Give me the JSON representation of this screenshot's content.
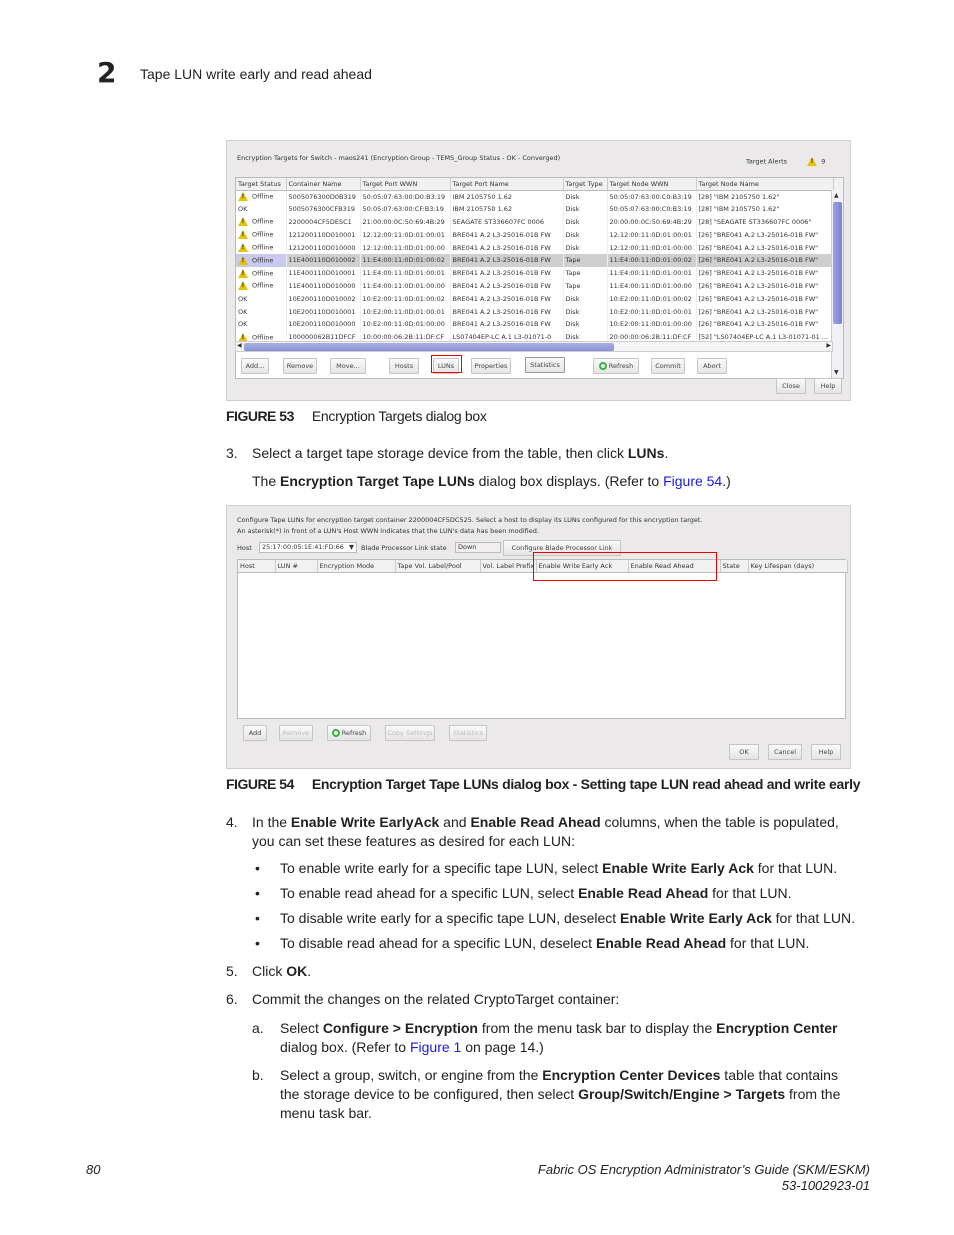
{
  "header": {
    "chapter_number": "2",
    "running_head": "Tape LUN write early and read ahead"
  },
  "figure53": {
    "dialog": {
      "title": "Encryption Targets for Switch - maos241 (Encryption Group - TEMS_Group Status - OK - Converged)",
      "target_alerts_label": "Target Alerts",
      "target_alerts_count": "9",
      "columns": [
        "Target Status",
        "Container Name",
        "Target Port WWN",
        "Target Port Name",
        "Target Type",
        "Target Node WWN",
        "Target Node Name"
      ],
      "rows": [
        {
          "status": "Offline",
          "warn": true,
          "container": "5005076300D0B319",
          "port_wwn": "50:05:07:63:00:D0:B3:19",
          "port_name": "IBM      2105750       1.62",
          "type": "Disk",
          "node_wwn": "50:05:07:63:00:C0:B3:19",
          "node_name": "[28] \"IBM      2105750       1.62\""
        },
        {
          "status": "OK",
          "warn": false,
          "container": "5005076300CFB319",
          "port_wwn": "50:05:07:63:00:CF:B3:19",
          "port_name": "IBM      2105750       1.62",
          "type": "Disk",
          "node_wwn": "50:05:07:63:00:C0:B3:19",
          "node_name": "[28] \"IBM      2105750       1.62\""
        },
        {
          "status": "Offline",
          "warn": true,
          "container": "2200004CF5DESC1",
          "port_wwn": "21:00:00:0C:50:69:4B:29",
          "port_name": "SEAGATE ST336607FC      0006",
          "type": "Disk",
          "node_wwn": "20:00:00:0C:50:69:4B:29",
          "node_name": "[28] \"SEAGATE ST336607FC      0006\""
        },
        {
          "status": "Offline",
          "warn": true,
          "container": "121200110D010001",
          "port_wwn": "12:12:00:11:0D:01:00:01",
          "port_name": "BRE041 A.2 L3-25016-01B FW",
          "type": "Disk",
          "node_wwn": "12:12:00:11:0D:01:00:01",
          "node_name": "[26] \"BRE041 A.2 L3-25016-01B FW\""
        },
        {
          "status": "Offline",
          "warn": true,
          "container": "121200110D010000",
          "port_wwn": "12:12:00:11:0D:01:00:00",
          "port_name": "BRE041 A.2 L3-25016-01B FW",
          "type": "Disk",
          "node_wwn": "12:12:00:11:0D:01:00:00",
          "node_name": "[26] \"BRE041 A.2 L3-25016-01B FW\""
        },
        {
          "status": "Offline",
          "warn": true,
          "selected": true,
          "container": "11E400110D010002",
          "port_wwn": "11:E4:00:11:0D:01:00:02",
          "port_name": "BRE041 A.2 L3-25016-01B FW",
          "type": "Tape",
          "node_wwn": "11:E4:00:11:0D:01:00:02",
          "node_name": "[26] \"BRE041 A.2 L3-25016-01B FW\""
        },
        {
          "status": "Offline",
          "warn": true,
          "container": "11E400110D010001",
          "port_wwn": "11:E4:00:11:0D:01:00:01",
          "port_name": "BRE041 A.2 L3-25016-01B FW",
          "type": "Tape",
          "node_wwn": "11:E4:00:11:0D:01:00:01",
          "node_name": "[26] \"BRE041 A.2 L3-25016-01B FW\""
        },
        {
          "status": "Offline",
          "warn": true,
          "container": "11E400110D010000",
          "port_wwn": "11:E4:00:11:0D:01:00:00",
          "port_name": "BRE041 A.2 L3-25016-01B FW",
          "type": "Tape",
          "node_wwn": "11:E4:00:11:0D:01:00:00",
          "node_name": "[26] \"BRE041 A.2 L3-25016-01B FW\""
        },
        {
          "status": "OK",
          "warn": false,
          "container": "10E200110D010002",
          "port_wwn": "10:E2:00:11:0D:01:00:02",
          "port_name": "BRE041 A.2 L3-25016-01B FW",
          "type": "Disk",
          "node_wwn": "10:E2:00:11:0D:01:00:02",
          "node_name": "[26] \"BRE041 A.2 L3-25016-01B FW\""
        },
        {
          "status": "OK",
          "warn": false,
          "container": "10E200110D010001",
          "port_wwn": "10:E2:00:11:0D:01:00:01",
          "port_name": "BRE041 A.2 L3-25016-01B FW",
          "type": "Disk",
          "node_wwn": "10:E2:00:11:0D:01:00:01",
          "node_name": "[26] \"BRE041 A.2 L3-25016-01B FW\""
        },
        {
          "status": "OK",
          "warn": false,
          "container": "10E200110D010000",
          "port_wwn": "10:E2:00:11:0D:01:00:00",
          "port_name": "BRE041 A.2 L3-25016-01B FW",
          "type": "Disk",
          "node_wwn": "10:E2:00:11:0D:01:00:00",
          "node_name": "[26] \"BRE041 A.2 L3-25016-01B FW\""
        },
        {
          "status": "Offline",
          "warn": true,
          "container": "100000062B11DFCF",
          "port_wwn": "10:00:00:06:2B:11:DF:CF",
          "port_name": "LS07404EP-LC A.1 L3-01071-0",
          "type": "Disk",
          "node_wwn": "20:00:00:06:2B:11:DF:CF",
          "node_name": "[52] \"LS07404EP-LC A.1 L3-01071-01 ..."
        }
      ],
      "buttons": {
        "add": "Add...",
        "remove": "Remove",
        "move": "Move...",
        "hosts": "Hosts",
        "luns": "LUNs",
        "properties": "Properties",
        "statistics": "Statistics",
        "refresh": "Refresh",
        "commit": "Commit",
        "abort": "Abort",
        "close": "Close",
        "help": "Help"
      }
    },
    "label": "FIGURE 53",
    "caption": "Encryption Targets dialog box"
  },
  "step3": {
    "number": "3.",
    "text_before": "Select a target tape storage device from the table, then click ",
    "bold": "LUNs",
    "text_after": ".",
    "sub_prefix": "The ",
    "sub_bold": "Encryption Target Tape LUNs",
    "sub_mid": " dialog box displays. (Refer to ",
    "sub_link": "Figure 54",
    "sub_suffix": ".)"
  },
  "figure54": {
    "dialog": {
      "line1": "Configure Tape LUNs for encryption target container 2200004CF5DC525. Select a host to display its LUNs configured for this encryption target.",
      "line2": "An asterisk(*) in front of a LUN's Host WWN indicates that the LUN's data has been modified.",
      "host_label": "Host",
      "host_value": "25:17:00:05:1E:41:FD:66",
      "blade_link_label": "Blade Processor Link state",
      "blade_link_value": "Down",
      "configure_blade_button": "Configure Blade Processor Link",
      "columns": [
        "Host",
        "LUN #",
        "Encryption Mode",
        "Tape Vol. Label/Pool",
        "Vol. Label Prefix",
        "Enable Write Early Ack",
        "Enable Read Ahead",
        "State",
        "Key Lifespan (days)"
      ],
      "buttons": {
        "add": "Add",
        "remove": "Remove",
        "refresh": "Refresh",
        "copy_settings": "Copy Settings",
        "statistics": "Statistics",
        "ok": "OK",
        "cancel": "Cancel",
        "help": "Help"
      }
    },
    "label": "FIGURE 54",
    "caption": "Encryption Target Tape LUNs dialog box - Setting tape LUN read ahead and write early"
  },
  "step4": {
    "number": "4.",
    "p1": "In the ",
    "b1": "Enable Write EarlyAck",
    "p2": " and ",
    "b2": "Enable Read Ahead",
    "p3": " columns, when the table is populated,",
    "line2": "you can set these features as desired for each LUN:",
    "bullets": [
      {
        "pre": "To enable write early for a specific tape LUN, select ",
        "bold": "Enable Write Early Ack",
        "post": " for that LUN."
      },
      {
        "pre": "To enable read ahead for a specific LUN, select ",
        "bold": "Enable Read Ahead",
        "post": " for that LUN."
      },
      {
        "pre": "To disable write early for a specific tape LUN, deselect ",
        "bold": "Enable Write Early Ack",
        "post": " for that LUN."
      },
      {
        "pre": "To disable read ahead for a specific LUN, deselect ",
        "bold": "Enable Read Ahead",
        "post": " for that LUN."
      }
    ]
  },
  "step5": {
    "number": "5.",
    "pre": "Click ",
    "bold": "OK",
    "post": "."
  },
  "step6": {
    "number": "6.",
    "text": "Commit the changes on the related CryptoTarget container:",
    "a": {
      "letter": "a.",
      "pre": "Select ",
      "b1": "Configure > Encryption",
      "mid": " from the menu task bar to display the ",
      "b2": "Encryption Center",
      "l2pre": "dialog box. (Refer to ",
      "link": "Figure 1",
      "l2post": " on page 14.)"
    },
    "b": {
      "letter": "b.",
      "pre": "Select a group, switch, or engine from the ",
      "b1": "Encryption Center Devices",
      "mid": " table that contains",
      "l2pre": "the storage device to be configured, then select ",
      "b2": "Group/Switch/Engine > Targets",
      "l2post": " from the",
      "l3": "menu task bar."
    }
  },
  "footer": {
    "page_number": "80",
    "guide_title": "Fabric OS Encryption Administrator’s Guide (SKM/ESKM)",
    "doc_number": "53-1002923-01"
  }
}
